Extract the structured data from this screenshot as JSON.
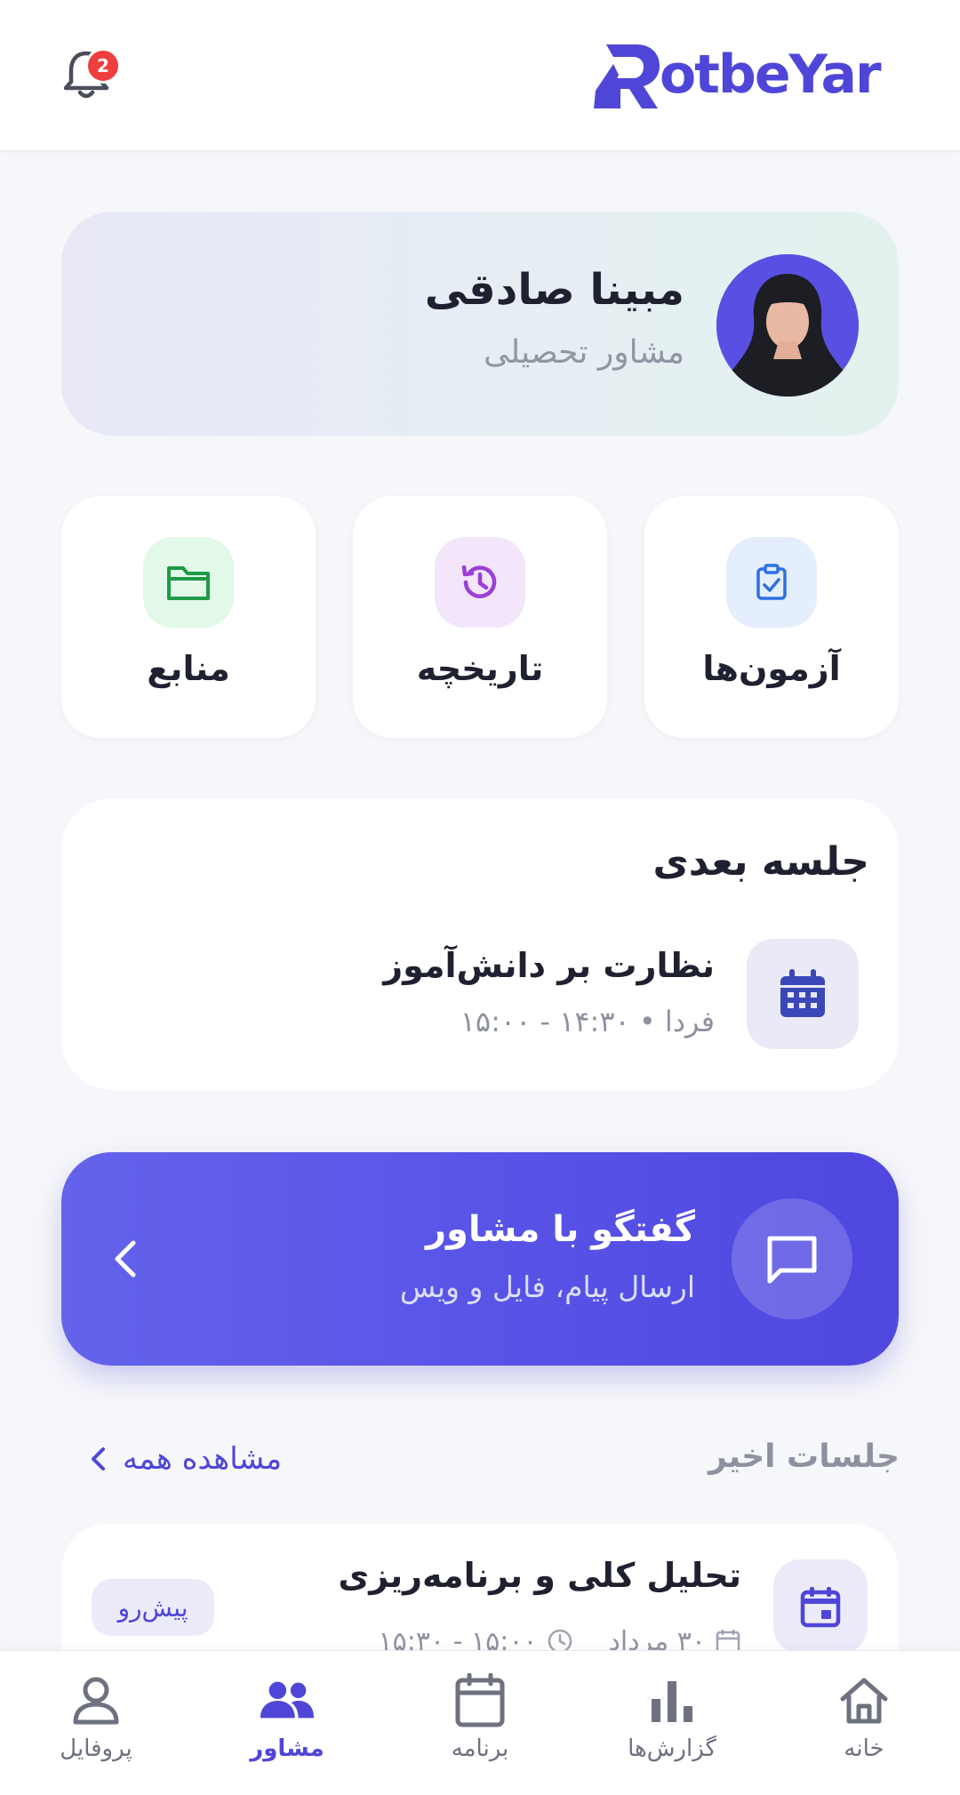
{
  "header": {
    "logo_text": "otbeYar",
    "notifications_count": "2"
  },
  "profile": {
    "name": "مبینا صادقی",
    "role": "مشاور تحصیلی"
  },
  "quick_actions": [
    {
      "label": "آزمون‌ها",
      "icon": "clipboard-check-icon"
    },
    {
      "label": "تاریخچه",
      "icon": "history-icon"
    },
    {
      "label": "منابع",
      "icon": "folder-icon"
    }
  ],
  "next_session": {
    "section_title": "جلسه بعدی",
    "title": "نظارت بر دانش‌آموز",
    "meta": "فردا • ۱۴:۳۰ - ۱۵:۰۰"
  },
  "chat": {
    "title": "گفتگو با مشاور",
    "subtitle": "ارسال پیام، فایل و ویس"
  },
  "recent_sessions": {
    "title": "جلسات اخیر",
    "see_all": "مشاهده همه",
    "items": [
      {
        "title": "تحلیل کلی و برنامه‌ریزی",
        "date": "۳۰ مرداد",
        "time": "۱۵:۰۰ - ۱۵:۳۰",
        "status": "پیش‌رو"
      }
    ]
  },
  "bottom_nav": [
    {
      "label": "خانه",
      "icon": "home-icon",
      "active": false
    },
    {
      "label": "گزارش‌ها",
      "icon": "bar-chart-icon",
      "active": false
    },
    {
      "label": "برنامه",
      "icon": "calendar-icon",
      "active": false
    },
    {
      "label": "مشاور",
      "icon": "people-icon",
      "active": true
    },
    {
      "label": "پروفایل",
      "icon": "user-icon",
      "active": false
    }
  ],
  "colors": {
    "brand": "#4f46d8",
    "badge_red": "#ef3e3e",
    "background": "#f6f7fa"
  }
}
